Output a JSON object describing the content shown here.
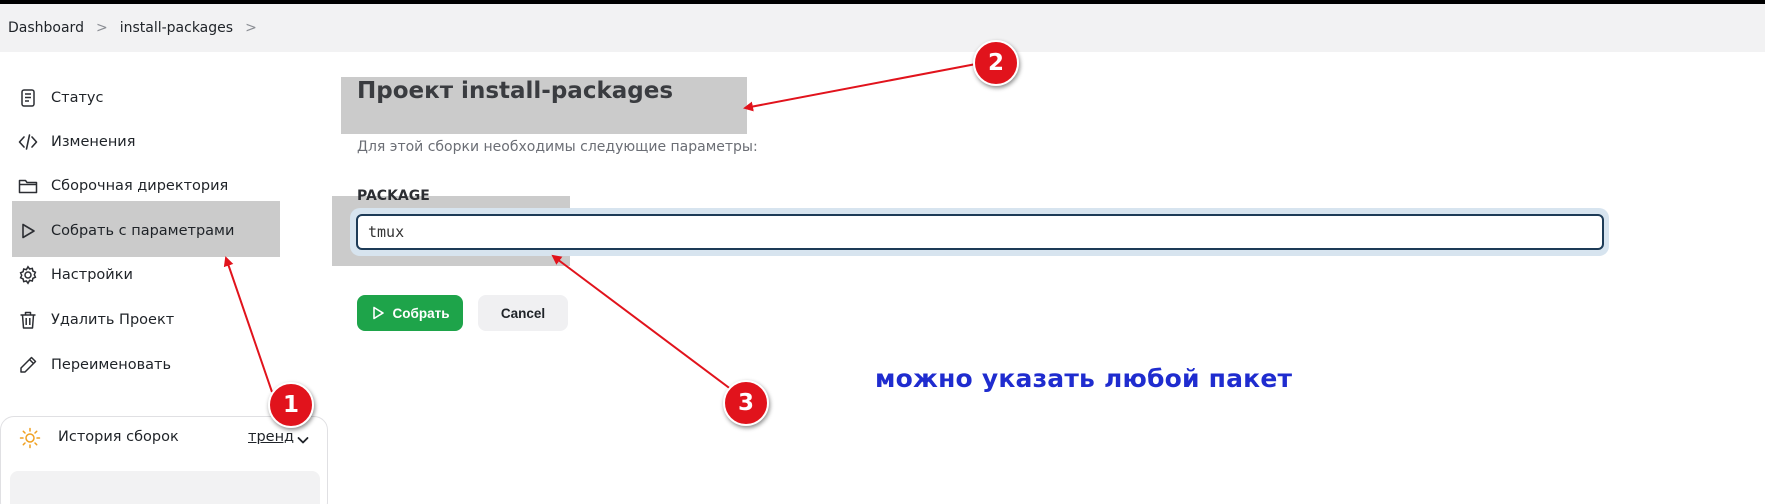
{
  "breadcrumb": {
    "items": [
      "Dashboard",
      "install-packages"
    ],
    "separator": ">"
  },
  "sidebar": {
    "items": [
      {
        "label": "Статус",
        "icon": "document-icon"
      },
      {
        "label": "Изменения",
        "icon": "code-icon"
      },
      {
        "label": "Сборочная директория",
        "icon": "folder-icon"
      },
      {
        "label": "Собрать с параметрами",
        "icon": "play-icon"
      },
      {
        "label": "Настройки",
        "icon": "gear-icon"
      },
      {
        "label": "Удалить Проект",
        "icon": "trash-icon"
      },
      {
        "label": "Переименовать",
        "icon": "pencil-icon"
      }
    ]
  },
  "history": {
    "title": "История сборок",
    "trend_label": "тренд",
    "icon": "sun-icon"
  },
  "main": {
    "title": "Проект install-packages",
    "subtitle": "Для этой сборки необходимы следующие параметры:",
    "param_name": "PACKAGE",
    "param_value": "tmux",
    "build_button": "Собрать",
    "cancel_button": "Cancel"
  },
  "annotations": {
    "badges": [
      "1",
      "2",
      "3"
    ],
    "note": "можно указать любой пакет",
    "badge_color": "#e1131c",
    "arrow_color": "#e1131c",
    "note_color": "#1f2ccf"
  },
  "colors": {
    "accent_green": "#1ea44a",
    "input_border": "#1d3b57",
    "breadcrumb_bg": "#f2f2f3"
  }
}
